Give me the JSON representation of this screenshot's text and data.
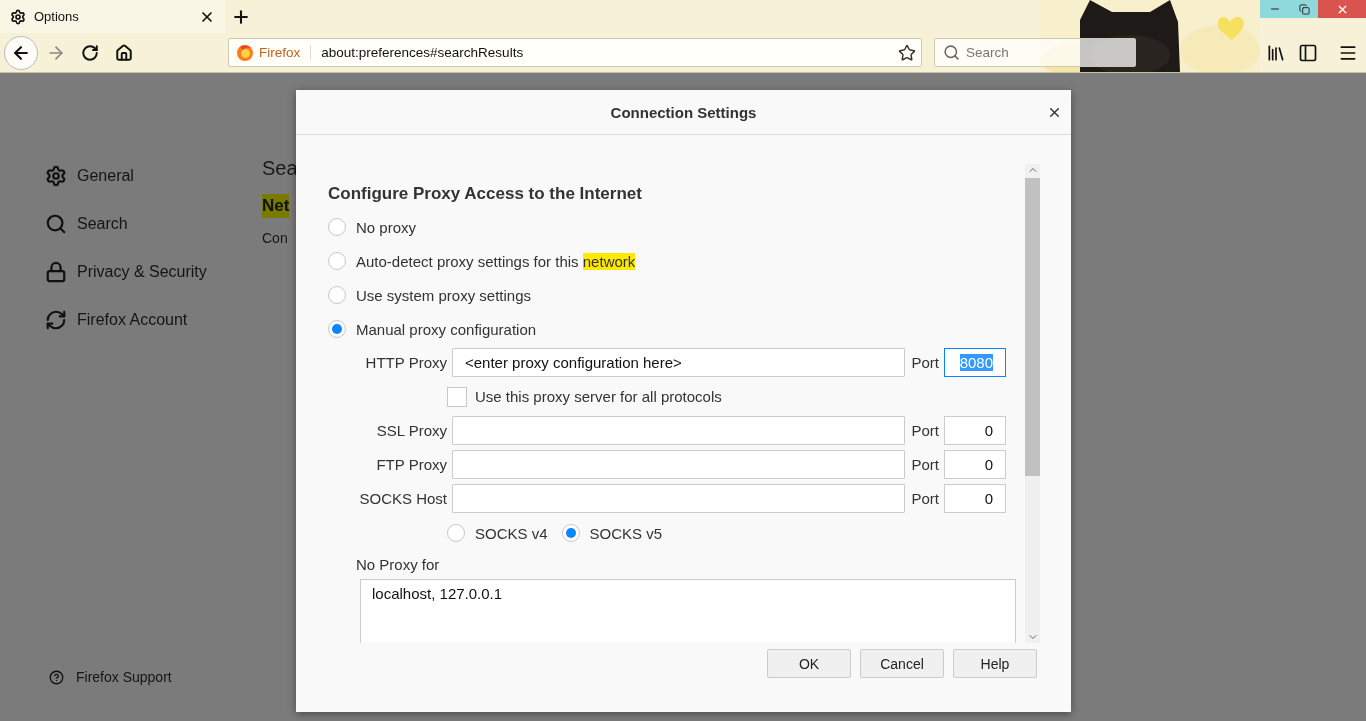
{
  "browser": {
    "tab": {
      "title": "Options"
    },
    "url": {
      "identity": "Firefox",
      "value": "about:preferences#searchResults"
    },
    "search": {
      "placeholder": "Search"
    }
  },
  "sidebar": {
    "items": [
      {
        "label": "General"
      },
      {
        "label": "Search"
      },
      {
        "label": "Privacy & Security"
      },
      {
        "label": "Firefox Account"
      }
    ],
    "support": {
      "label": "Firefox Support"
    }
  },
  "page": {
    "heading": "Sea",
    "highlight": "Net",
    "text": "Con"
  },
  "dialog": {
    "title": "Connection Settings",
    "heading": "Configure Proxy Access to the Internet",
    "modes": [
      {
        "label": "No proxy",
        "selected": false
      },
      {
        "label": "Auto-detect proxy settings for this ",
        "highlight": "network",
        "selected": false
      },
      {
        "label": "Use system proxy settings",
        "selected": false
      },
      {
        "label": "Manual proxy configuration",
        "selected": true
      }
    ],
    "proxies": [
      {
        "label": "HTTP Proxy",
        "value": "<enter proxy configuration here>",
        "port_label": "Port",
        "port": "8080",
        "focused": true
      },
      {
        "label": "SSL Proxy",
        "port_label": "Port",
        "port": "0",
        "focused": false
      },
      {
        "label": "FTP Proxy",
        "port_label": "Port",
        "port": "0",
        "focused": false
      },
      {
        "label": "SOCKS Host",
        "port_label": "Port",
        "port": "0",
        "focused": false
      }
    ],
    "share_all": {
      "label": "Use this proxy server for all protocols",
      "checked": false
    },
    "socks_versions": [
      {
        "label": "SOCKS v4",
        "selected": false
      },
      {
        "label": "SOCKS v5",
        "selected": true
      }
    ],
    "no_proxy": {
      "label": "No Proxy for",
      "value": "localhost, 127.0.0.1"
    },
    "buttons": [
      {
        "label": "OK"
      },
      {
        "label": "Cancel"
      },
      {
        "label": "Help"
      }
    ]
  }
}
